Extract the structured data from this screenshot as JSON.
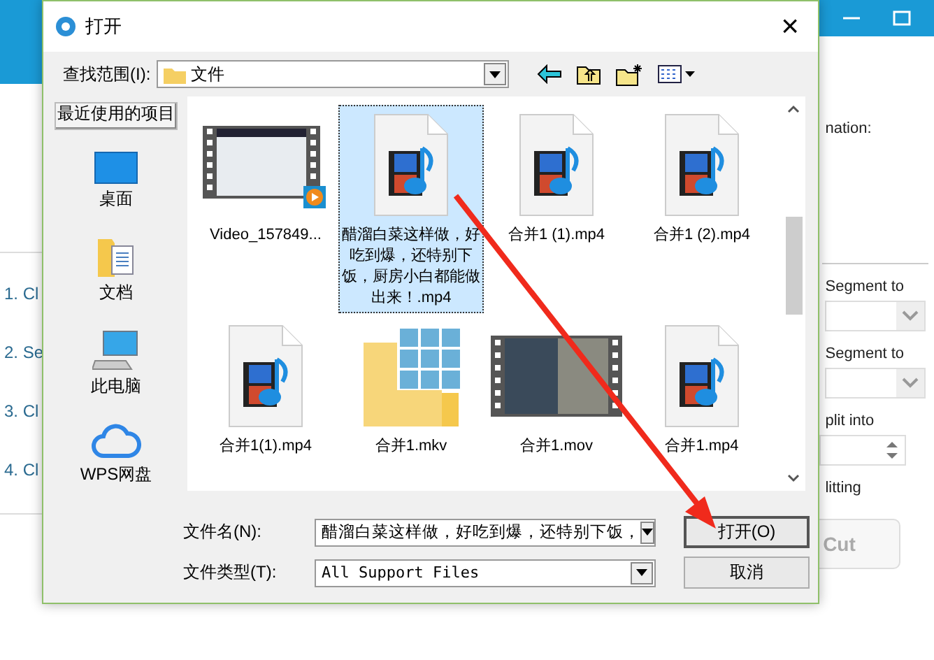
{
  "app": {
    "steps": [
      "1. Cl",
      "2. Se",
      "3. Cl",
      "4. Cl"
    ],
    "panel": {
      "destination_label": "nation:",
      "segment_label_1": "Segment to",
      "segment_label_2": "Segment to",
      "split_label": "plit into",
      "splitting_label": "litting",
      "cut_button": "Cut"
    }
  },
  "dialog": {
    "title": "打开",
    "close": "×",
    "look_in": {
      "label": "查找范围(I):",
      "value": "文件"
    },
    "places": [
      {
        "label": "最近使用的项目",
        "kind": "recent",
        "selected": true
      },
      {
        "label": "桌面",
        "kind": "desktop",
        "selected": false
      },
      {
        "label": "文档",
        "kind": "documents",
        "selected": false
      },
      {
        "label": "此电脑",
        "kind": "computer",
        "selected": false
      },
      {
        "label": "WPS网盘",
        "kind": "cloud",
        "selected": false
      }
    ],
    "files": [
      {
        "name": "Video_157849...",
        "kind": "video",
        "selected": false
      },
      {
        "name": "醋溜白菜这样做，好吃到爆，还特别下饭，厨房小白都能做出来！.mp4",
        "kind": "media",
        "selected": true
      },
      {
        "name": "合并1 (1).mp4",
        "kind": "media",
        "selected": false
      },
      {
        "name": "合并1 (2).mp4",
        "kind": "media",
        "selected": false
      },
      {
        "name": "合并1(1).mp4",
        "kind": "media",
        "selected": false
      },
      {
        "name": "合并1.mkv",
        "kind": "folder",
        "selected": false
      },
      {
        "name": "合并1.mov",
        "kind": "movie",
        "selected": false
      },
      {
        "name": "合并1.mp4",
        "kind": "media",
        "selected": false
      }
    ],
    "file_name": {
      "label": "文件名(N):",
      "value": "醋溜白菜这样做，好吃到爆，还特别下饭，"
    },
    "file_type": {
      "label": "文件类型(T):",
      "value": "All Support Files"
    },
    "open_button": "打开(O)",
    "cancel_button": "取消"
  }
}
